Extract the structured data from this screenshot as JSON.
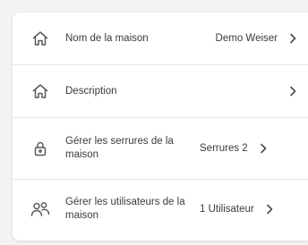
{
  "settings": {
    "rows": [
      {
        "icon": "home-icon",
        "label": "Nom de la maison",
        "value": "Demo Weiser"
      },
      {
        "icon": "home-icon",
        "label": "Description",
        "value": ""
      },
      {
        "icon": "lock-icon",
        "label": "Gérer les serrures de la maison",
        "value": "Serrures 2"
      },
      {
        "icon": "users-icon",
        "label": "Gérer les utilisateurs de la maison",
        "value": "1 Utilisateur"
      }
    ]
  }
}
